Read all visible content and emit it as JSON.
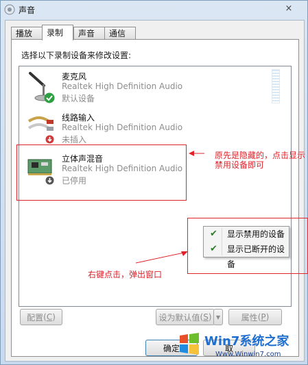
{
  "window": {
    "title": "声音",
    "close_label": "×"
  },
  "tabs": [
    {
      "label": "播放",
      "active": false
    },
    {
      "label": "录制",
      "active": true
    },
    {
      "label": "声音",
      "active": false
    },
    {
      "label": "通信",
      "active": false
    }
  ],
  "instruction": "选择以下录制设备来修改设置:",
  "devices": [
    {
      "name": "麦克风",
      "driver": "Realtek High Definition Audio",
      "status": "默认设备",
      "icon": "microphone-icon",
      "badge": "default-check-icon"
    },
    {
      "name": "线路输入",
      "driver": "Realtek High Definition Audio",
      "status": "未插入",
      "icon": "line-in-cable-icon",
      "badge": "unplugged-icon"
    },
    {
      "name": "立体声混音",
      "driver": "Realtek High Definition Audio",
      "status": "已停用",
      "icon": "sound-card-icon",
      "badge": "disabled-icon"
    }
  ],
  "buttons": {
    "configure": {
      "label": "配置",
      "key": "C"
    },
    "set_default": {
      "label": "设为默认值",
      "key": "S"
    },
    "properties": {
      "label": "属性",
      "key": "P"
    },
    "ok": "确定",
    "cancel": "取"
  },
  "context_menu": [
    {
      "label": "显示禁用的设备",
      "checked": true
    },
    {
      "label": "显示已断开的设备",
      "checked": true
    }
  ],
  "annotations": {
    "hidden_note_line1": "原先是隐藏的，点击显示",
    "hidden_note_line2": "禁用设备即可",
    "right_click_note": "右键点击，弹出窗口"
  },
  "watermark": {
    "brand": "Win7系统之家",
    "url": "Www.Winwin7.com"
  },
  "colors": {
    "annotation": "#e0222a",
    "check": "#2f7a2f",
    "disabled_text": "#8c8c8c"
  }
}
